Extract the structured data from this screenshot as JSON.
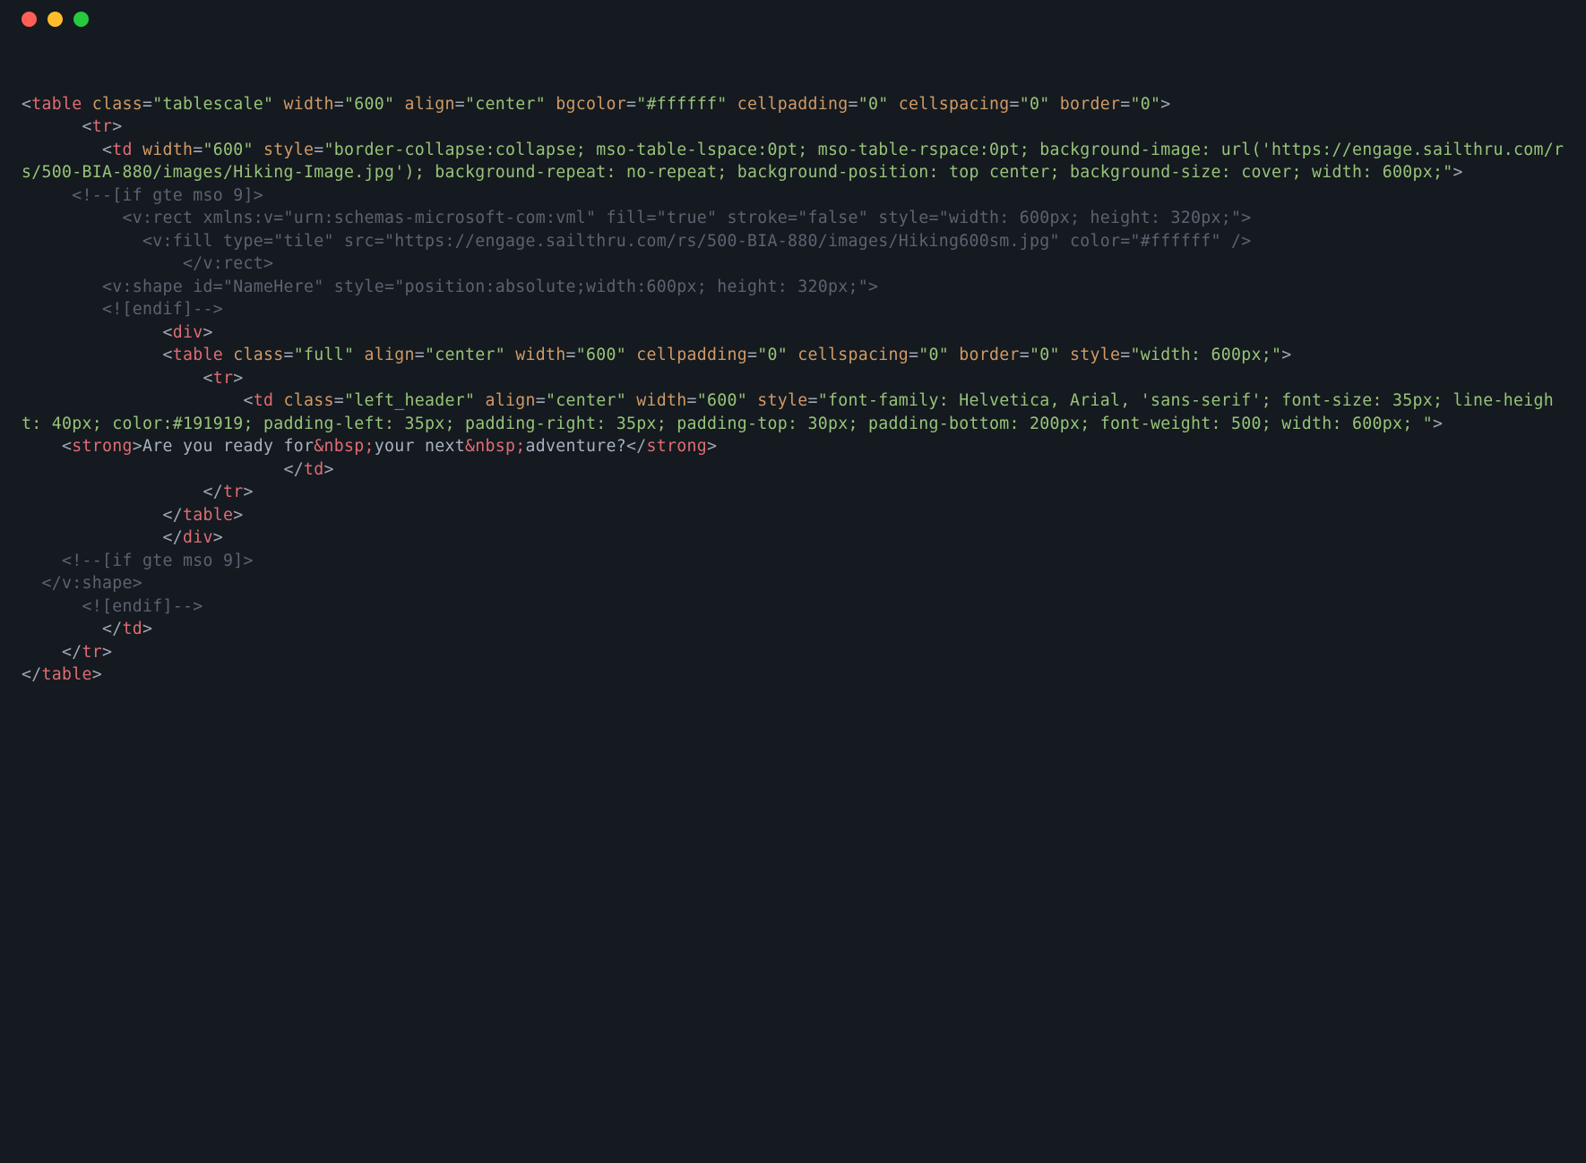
{
  "titlebar": {
    "close": "close",
    "min": "minimize",
    "max": "maximize"
  },
  "lines": [
    [
      {
        "c": "punct",
        "t": "<"
      },
      {
        "c": "tag",
        "t": "table"
      },
      {
        "c": "text",
        "t": " "
      },
      {
        "c": "attr",
        "t": "class"
      },
      {
        "c": "punct",
        "t": "="
      },
      {
        "c": "str",
        "t": "\"tablescale\""
      },
      {
        "c": "text",
        "t": " "
      },
      {
        "c": "attr",
        "t": "width"
      },
      {
        "c": "punct",
        "t": "="
      },
      {
        "c": "str",
        "t": "\"600\""
      },
      {
        "c": "text",
        "t": " "
      },
      {
        "c": "attr",
        "t": "align"
      },
      {
        "c": "punct",
        "t": "="
      },
      {
        "c": "str",
        "t": "\"center\""
      },
      {
        "c": "text",
        "t": " "
      },
      {
        "c": "attr",
        "t": "bgcolor"
      },
      {
        "c": "punct",
        "t": "="
      },
      {
        "c": "str",
        "t": "\"#ffffff\""
      },
      {
        "c": "text",
        "t": " "
      },
      {
        "c": "attr",
        "t": "cellpadding"
      },
      {
        "c": "punct",
        "t": "="
      },
      {
        "c": "str",
        "t": "\"0\""
      },
      {
        "c": "text",
        "t": " "
      },
      {
        "c": "attr",
        "t": "cellspacing"
      },
      {
        "c": "punct",
        "t": "="
      },
      {
        "c": "str",
        "t": "\"0\""
      },
      {
        "c": "text",
        "t": " "
      },
      {
        "c": "attr",
        "t": "border"
      },
      {
        "c": "punct",
        "t": "="
      },
      {
        "c": "str",
        "t": "\"0\""
      },
      {
        "c": "punct",
        "t": ">"
      }
    ],
    [
      {
        "c": "text",
        "t": "      "
      },
      {
        "c": "punct",
        "t": "<"
      },
      {
        "c": "tag",
        "t": "tr"
      },
      {
        "c": "punct",
        "t": ">"
      }
    ],
    [
      {
        "c": "text",
        "t": "        "
      },
      {
        "c": "punct",
        "t": "<"
      },
      {
        "c": "tag",
        "t": "td"
      },
      {
        "c": "text",
        "t": " "
      },
      {
        "c": "attr",
        "t": "width"
      },
      {
        "c": "punct",
        "t": "="
      },
      {
        "c": "str",
        "t": "\"600\""
      },
      {
        "c": "text",
        "t": " "
      },
      {
        "c": "attr",
        "t": "style"
      },
      {
        "c": "punct",
        "t": "="
      },
      {
        "c": "str",
        "t": "\"border-collapse:collapse; mso-table-lspace:0pt; mso-table-rspace:0pt; background-image: url('https://engage.sailthru.com/rs/500-BIA-880/images/Hiking-Image.jpg'); background-repeat: no-repeat; background-position: top center; background-size: cover; width: 600px;\""
      },
      {
        "c": "punct",
        "t": ">"
      }
    ],
    [
      {
        "c": "text",
        "t": "     "
      },
      {
        "c": "comment",
        "t": "<!--[if gte mso 9]>"
      }
    ],
    [
      {
        "c": "comment",
        "t": "          <v:rect xmlns:v=\"urn:schemas-microsoft-com:vml\" fill=\"true\" stroke=\"false\" style=\"width: 600px; height: 320px;\">"
      }
    ],
    [
      {
        "c": "comment",
        "t": "            <v:fill type=\"tile\" src=\"https://engage.sailthru.com/rs/500-BIA-880/images/Hiking600sm.jpg\" color=\"#ffffff\" />"
      }
    ],
    [
      {
        "c": "comment",
        "t": "                </v:rect>"
      }
    ],
    [
      {
        "c": "comment",
        "t": "        <v:shape id=\"NameHere\" style=\"position:absolute;width:600px; height: 320px;\">"
      }
    ],
    [
      {
        "c": "comment",
        "t": "        <![endif]-->"
      }
    ],
    [
      {
        "c": "text",
        "t": "              "
      },
      {
        "c": "punct",
        "t": "<"
      },
      {
        "c": "tag",
        "t": "div"
      },
      {
        "c": "punct",
        "t": ">"
      }
    ],
    [
      {
        "c": "text",
        "t": "              "
      },
      {
        "c": "punct",
        "t": "<"
      },
      {
        "c": "tag",
        "t": "table"
      },
      {
        "c": "text",
        "t": " "
      },
      {
        "c": "attr",
        "t": "class"
      },
      {
        "c": "punct",
        "t": "="
      },
      {
        "c": "str",
        "t": "\"full\""
      },
      {
        "c": "text",
        "t": " "
      },
      {
        "c": "attr",
        "t": "align"
      },
      {
        "c": "punct",
        "t": "="
      },
      {
        "c": "str",
        "t": "\"center\""
      },
      {
        "c": "text",
        "t": " "
      },
      {
        "c": "attr",
        "t": "width"
      },
      {
        "c": "punct",
        "t": "="
      },
      {
        "c": "str",
        "t": "\"600\""
      },
      {
        "c": "text",
        "t": " "
      },
      {
        "c": "attr",
        "t": "cellpadding"
      },
      {
        "c": "punct",
        "t": "="
      },
      {
        "c": "str",
        "t": "\"0\""
      },
      {
        "c": "text",
        "t": " "
      },
      {
        "c": "attr",
        "t": "cellspacing"
      },
      {
        "c": "punct",
        "t": "="
      },
      {
        "c": "str",
        "t": "\"0\""
      },
      {
        "c": "text",
        "t": " "
      },
      {
        "c": "attr",
        "t": "border"
      },
      {
        "c": "punct",
        "t": "="
      },
      {
        "c": "str",
        "t": "\"0\""
      },
      {
        "c": "text",
        "t": " "
      },
      {
        "c": "attr",
        "t": "style"
      },
      {
        "c": "punct",
        "t": "="
      },
      {
        "c": "str",
        "t": "\"width: 600px;\""
      },
      {
        "c": "punct",
        "t": ">"
      }
    ],
    [
      {
        "c": "text",
        "t": "                  "
      },
      {
        "c": "punct",
        "t": "<"
      },
      {
        "c": "tag",
        "t": "tr"
      },
      {
        "c": "punct",
        "t": ">"
      }
    ],
    [
      {
        "c": "text",
        "t": "                      "
      },
      {
        "c": "punct",
        "t": "<"
      },
      {
        "c": "tag",
        "t": "td"
      },
      {
        "c": "text",
        "t": " "
      },
      {
        "c": "attr",
        "t": "class"
      },
      {
        "c": "punct",
        "t": "="
      },
      {
        "c": "str",
        "t": "\"left_header\""
      },
      {
        "c": "text",
        "t": " "
      },
      {
        "c": "attr",
        "t": "align"
      },
      {
        "c": "punct",
        "t": "="
      },
      {
        "c": "str",
        "t": "\"center\""
      },
      {
        "c": "text",
        "t": " "
      },
      {
        "c": "attr",
        "t": "width"
      },
      {
        "c": "punct",
        "t": "="
      },
      {
        "c": "str",
        "t": "\"600\""
      },
      {
        "c": "text",
        "t": " "
      },
      {
        "c": "attr",
        "t": "style"
      },
      {
        "c": "punct",
        "t": "="
      },
      {
        "c": "str",
        "t": "\"font-family: Helvetica, Arial, 'sans-serif'; font-size: 35px; line-height: 40px; color:#191919; padding-left: 35px; padding-right: 35px; padding-top: 30px; padding-bottom: 200px; font-weight: 500; width: 600px; \""
      },
      {
        "c": "punct",
        "t": ">"
      }
    ],
    [
      {
        "c": "text",
        "t": "    "
      },
      {
        "c": "punct",
        "t": "<"
      },
      {
        "c": "tag",
        "t": "strong"
      },
      {
        "c": "punct",
        "t": ">"
      },
      {
        "c": "text",
        "t": "Are you ready for"
      },
      {
        "c": "ent",
        "t": "&nbsp;"
      },
      {
        "c": "text",
        "t": "your next"
      },
      {
        "c": "ent",
        "t": "&nbsp;"
      },
      {
        "c": "text",
        "t": "adventure?"
      },
      {
        "c": "punct",
        "t": "</"
      },
      {
        "c": "tag",
        "t": "strong"
      },
      {
        "c": "punct",
        "t": ">"
      }
    ],
    [
      {
        "c": "text",
        "t": "                          "
      },
      {
        "c": "punct",
        "t": "</"
      },
      {
        "c": "tag",
        "t": "td"
      },
      {
        "c": "punct",
        "t": ">"
      }
    ],
    [
      {
        "c": "text",
        "t": "                  "
      },
      {
        "c": "punct",
        "t": "</"
      },
      {
        "c": "tag",
        "t": "tr"
      },
      {
        "c": "punct",
        "t": ">"
      }
    ],
    [
      {
        "c": "text",
        "t": "              "
      },
      {
        "c": "punct",
        "t": "</"
      },
      {
        "c": "tag",
        "t": "table"
      },
      {
        "c": "punct",
        "t": ">"
      }
    ],
    [
      {
        "c": "text",
        "t": "              "
      },
      {
        "c": "punct",
        "t": "</"
      },
      {
        "c": "tag",
        "t": "div"
      },
      {
        "c": "punct",
        "t": ">"
      }
    ],
    [
      {
        "c": "text",
        "t": "    "
      },
      {
        "c": "comment",
        "t": "<!--[if gte mso 9]>"
      }
    ],
    [
      {
        "c": "comment",
        "t": "  </v:shape>"
      }
    ],
    [
      {
        "c": "comment",
        "t": "      <![endif]-->"
      }
    ],
    [
      {
        "c": "text",
        "t": "        "
      },
      {
        "c": "punct",
        "t": "</"
      },
      {
        "c": "tag",
        "t": "td"
      },
      {
        "c": "punct",
        "t": ">"
      }
    ],
    [
      {
        "c": "text",
        "t": "    "
      },
      {
        "c": "punct",
        "t": "</"
      },
      {
        "c": "tag",
        "t": "tr"
      },
      {
        "c": "punct",
        "t": ">"
      }
    ],
    [
      {
        "c": "punct",
        "t": "</"
      },
      {
        "c": "tag",
        "t": "table"
      },
      {
        "c": "punct",
        "t": ">"
      }
    ]
  ]
}
